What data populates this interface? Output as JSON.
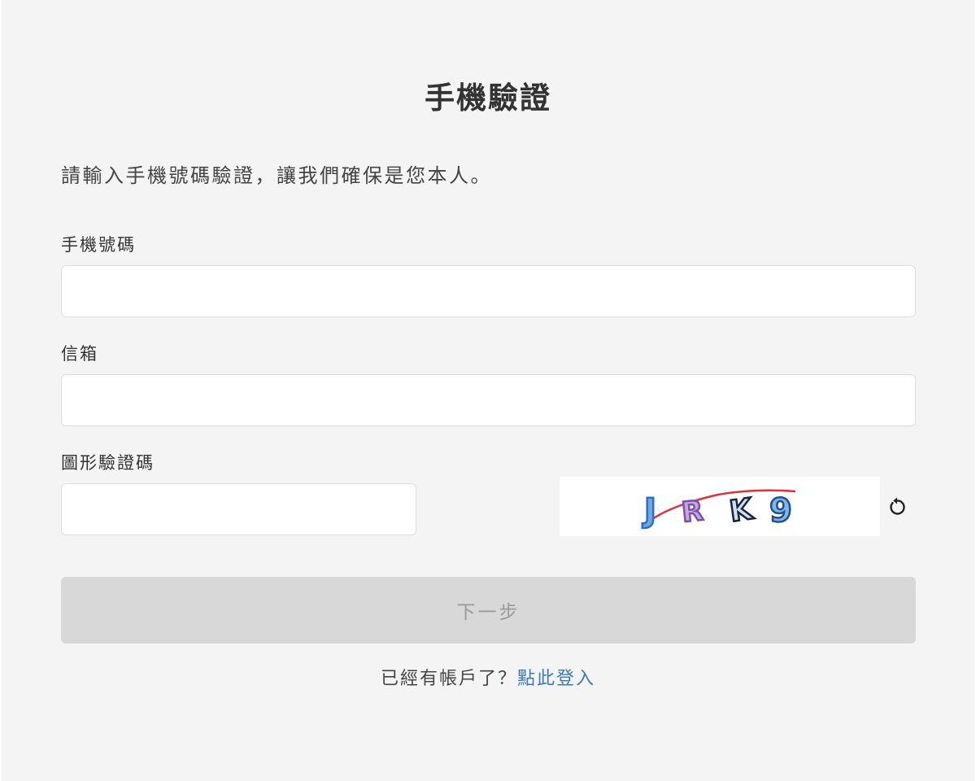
{
  "page": {
    "title": "手機驗證",
    "intro": "請輸入手機號碼驗證，讓我們確保是您本人。"
  },
  "form": {
    "phone_label": "手機號碼",
    "phone_value": "",
    "email_label": "信箱",
    "email_value": "",
    "captcha_label": "圖形驗證碼",
    "captcha_value": "",
    "captcha_image_text": "JRK9"
  },
  "actions": {
    "next_label": "下一步",
    "login_prompt": "已經有帳戶了？",
    "login_link": "點此登入"
  },
  "icons": {
    "refresh": "refresh-icon"
  },
  "colors": {
    "background": "#f4f4f4",
    "button_disabled": "#d8d8d8",
    "link": "#3d7ab8"
  }
}
